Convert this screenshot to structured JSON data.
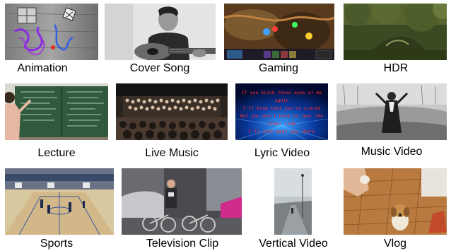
{
  "categories": [
    {
      "id": "animation",
      "label": "Animation"
    },
    {
      "id": "cover-song",
      "label": "Cover Song"
    },
    {
      "id": "gaming",
      "label": "Gaming"
    },
    {
      "id": "hdr",
      "label": "HDR"
    },
    {
      "id": "lecture",
      "label": "Lecture"
    },
    {
      "id": "live-music",
      "label": "Live Music"
    },
    {
      "id": "lyric-video",
      "label": "Lyric Video"
    },
    {
      "id": "music-video",
      "label": "Music Video"
    },
    {
      "id": "sports",
      "label": "Sports"
    },
    {
      "id": "television-clip",
      "label": "Television Clip"
    },
    {
      "id": "vertical-video",
      "label": "Vertical Video"
    },
    {
      "id": "vlog",
      "label": "Vlog"
    }
  ],
  "lyric_lines": [
    "If you blink those eyes at me again",
    "I'll know that you're scared",
    "But you don't have to fear the",
    "other side",
    "I'll just meet you there"
  ]
}
